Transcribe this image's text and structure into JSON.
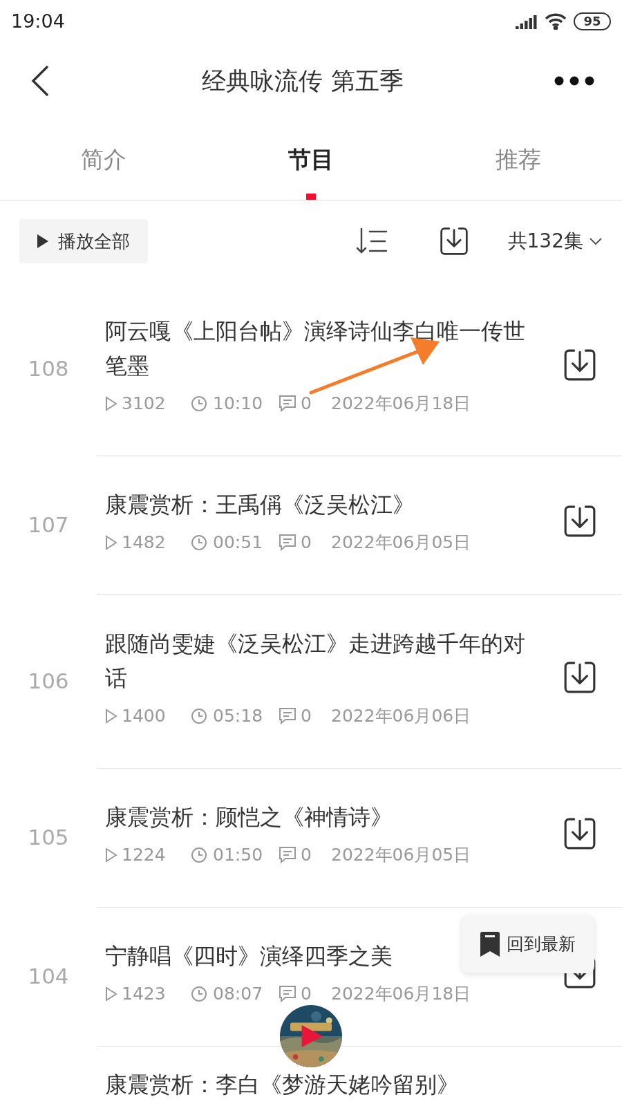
{
  "status_bar": {
    "time": "19:04",
    "battery": "95"
  },
  "nav": {
    "title": "经典咏流传 第五季"
  },
  "tabs": [
    {
      "label": "简介",
      "selected": false
    },
    {
      "label": "节目",
      "selected": true
    },
    {
      "label": "推荐",
      "selected": false
    }
  ],
  "toolbar": {
    "play_all": "播放全部",
    "count": "共132集"
  },
  "episodes": [
    {
      "kind": "full",
      "number": "108",
      "title": "阿云嘎《上阳台帖》演绎诗仙李白唯一传世笔墨",
      "plays": "3102",
      "duration": "10:10",
      "comments": "0",
      "date": "2022年06月18日"
    },
    {
      "kind": "full",
      "number": "107",
      "title": "康震赏析：王禹偁《泛吴松江》",
      "plays": "1482",
      "duration": "00:51",
      "comments": "0",
      "date": "2022年06月05日"
    },
    {
      "kind": "full",
      "number": "106",
      "title": "跟随尚雯婕《泛吴松江》走进跨越千年的对话",
      "plays": "1400",
      "duration": "05:18",
      "comments": "0",
      "date": "2022年06月06日"
    },
    {
      "kind": "full",
      "number": "105",
      "title": "康震赏析：顾恺之《神情诗》",
      "plays": "1224",
      "duration": "01:50",
      "comments": "0",
      "date": "2022年06月05日"
    },
    {
      "kind": "full",
      "number": "104",
      "title": "宁静唱《四时》演绎四季之美",
      "plays": "1423",
      "duration": "08:07",
      "comments": "0",
      "date": "2022年06月18日"
    },
    {
      "kind": "title_only",
      "title": "康震赏析：李白《梦游天姥吟留别》"
    }
  ],
  "float_button": {
    "label": "回到最新"
  }
}
